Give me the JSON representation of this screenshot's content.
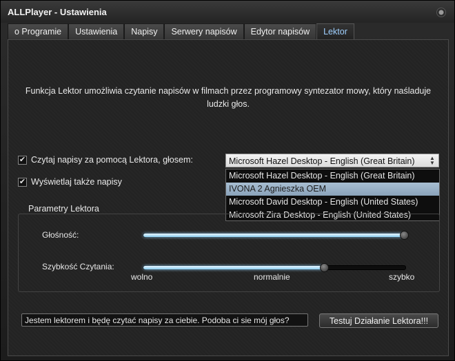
{
  "window": {
    "title": "ALLPlayer - Ustawienia"
  },
  "tabs": [
    {
      "label": "o Programie"
    },
    {
      "label": "Ustawienia"
    },
    {
      "label": "Napisy"
    },
    {
      "label": "Serwery napisów"
    },
    {
      "label": "Edytor napisów"
    },
    {
      "label": "Lektor",
      "active": true
    }
  ],
  "lektor": {
    "description": "Funkcja Lektor umożliwia czytanie napisów w filmach przez programowy syntezator mowy, który naśladuje ludzki głos.",
    "read_checkbox": {
      "label": "Czytaj napisy za pomocą Lektora, głosem:",
      "checked": true
    },
    "show_checkbox": {
      "label": "Wyświetlaj także napisy",
      "checked": true
    },
    "voice_select": {
      "value": "Microsoft Hazel Desktop - English (Great Britain)",
      "options": [
        "Microsoft Hazel Desktop - English (Great Britain)",
        "IVONA 2 Agnieszka OEM",
        "Microsoft David Desktop - English (United States)",
        "Microsoft Zira Desktop - English (United States)"
      ],
      "highlighted_index": 1
    },
    "params": {
      "title": "Parametry Lektora",
      "volume": {
        "label": "Głośność:",
        "level_pct": 100
      },
      "speed": {
        "label": "Szybkość Czytania:",
        "level_pct": 69,
        "tick_labels": [
          "wolno",
          "normalnie",
          "szybko"
        ]
      }
    },
    "test_text": "Jestem lektorem i będę czytać napisy za ciebie. Podoba ci sie mój głos?",
    "test_button": "Testuj Działanie Lektora!!!"
  },
  "colors": {
    "accent": "#9fd0ff",
    "slider_fill": "#8ccff0",
    "highlight": "#9bb3c9"
  }
}
